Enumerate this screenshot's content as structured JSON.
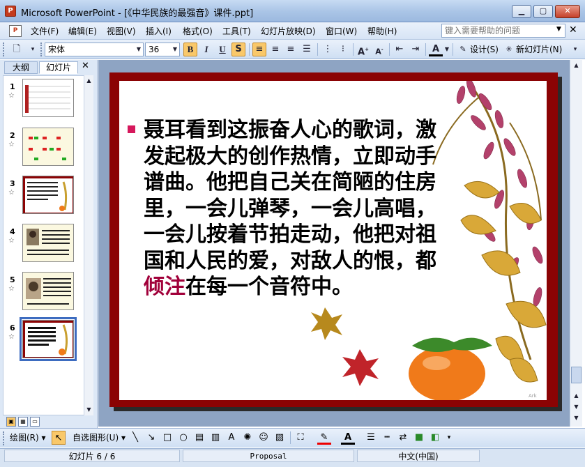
{
  "window": {
    "title": "Microsoft PowerPoint - [《中华民族的最强音》课件.ppt]",
    "app_icon_glyph": "P"
  },
  "menu": {
    "items": [
      "文件(F)",
      "编辑(E)",
      "视图(V)",
      "插入(I)",
      "格式(O)",
      "工具(T)",
      "幻灯片放映(D)",
      "窗口(W)",
      "帮助(H)"
    ],
    "help_placeholder": "键入需要帮助的问题"
  },
  "toolbar": {
    "font_name": "宋体",
    "font_size": "36",
    "bold": "B",
    "italic": "I",
    "underline": "U",
    "shadow": "S",
    "design_label": "设计(S)",
    "new_slide_label": "新幻灯片(N)",
    "active_align": "left"
  },
  "left_pane": {
    "tabs": [
      "大纲",
      "幻灯片"
    ],
    "active_tab": "幻灯片",
    "slides": [
      {
        "num": "1",
        "selected": false
      },
      {
        "num": "2",
        "selected": false
      },
      {
        "num": "3",
        "selected": false
      },
      {
        "num": "4",
        "selected": false
      },
      {
        "num": "5",
        "selected": false
      },
      {
        "num": "6",
        "selected": true
      }
    ]
  },
  "slide": {
    "text_before": "聂耳看到这振奋人心的歌词，激发起极大的创作热情，立即动手谱曲。他把自己关在简陋的住房里，一会儿弹琴，一会儿高唱，一会儿按着节拍走动，他把对祖国和人民的爱，对敌人的恨，都",
    "text_highlight": "倾注",
    "text_after": "在每一个音符中。",
    "watermark": "Ark",
    "colors": {
      "frame": "#8b0304",
      "bullet": "#d6185c",
      "highlight": "#a1003a"
    }
  },
  "draw_toolbar": {
    "draw_label": "绘图(R)",
    "autoshape_label": "自选图形(U)"
  },
  "status": {
    "slide_pos": "幻灯片 6 / 6",
    "design": "Proposal",
    "language": "中文(中国)"
  }
}
